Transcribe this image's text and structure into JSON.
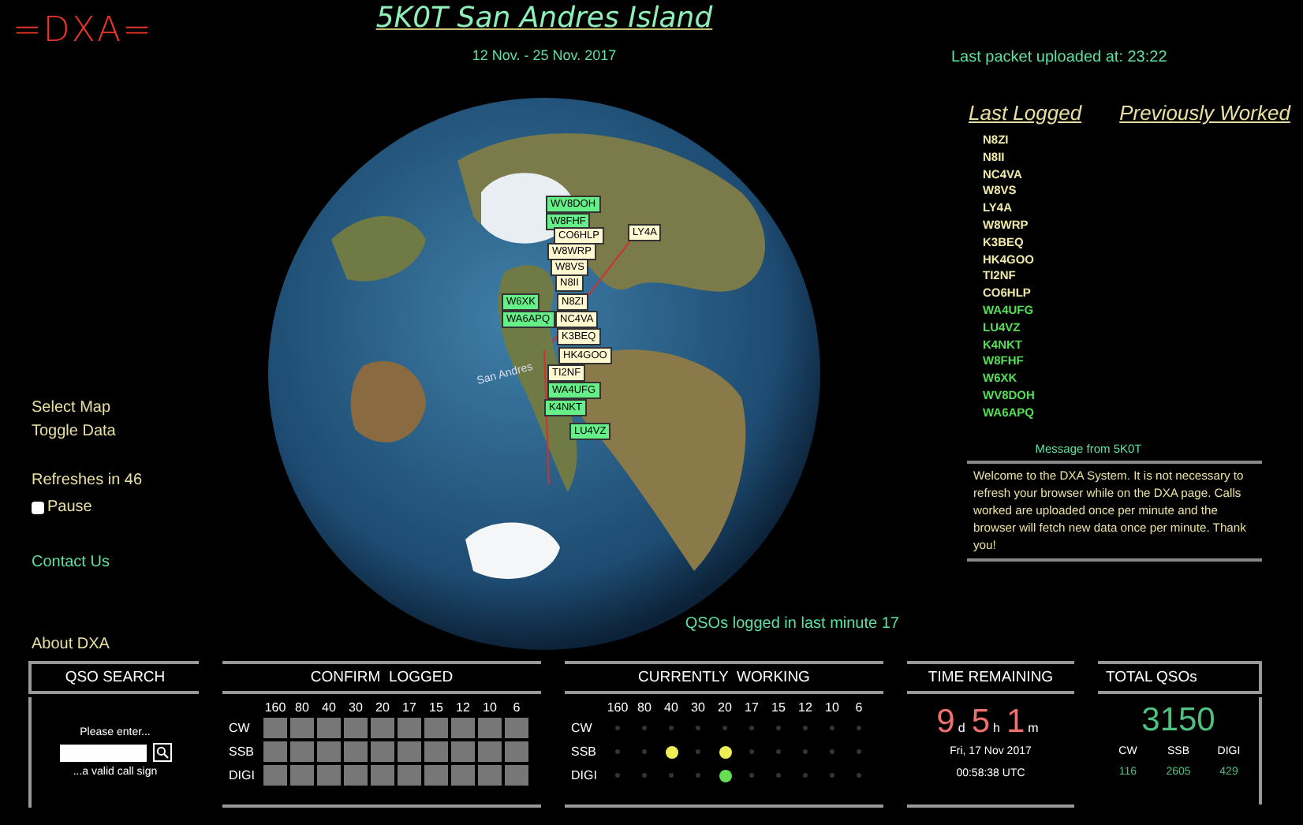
{
  "logo": "=DXA=",
  "title": "5K0T San Andres Island",
  "dates": "12 Nov. - 25 Nov. 2017",
  "last_packet": "Last packet uploaded at: 23:22",
  "nav": [
    {
      "label": "Select Map"
    },
    {
      "label": "Toggle Data"
    }
  ],
  "refresh": "Refreshes in 46",
  "pause": {
    "label": "Pause",
    "checked": false
  },
  "contact": "Contact Us",
  "about": "About DXA",
  "map": {
    "location_label": "San Andres",
    "markers": [
      {
        "call": "WV8DOH",
        "color": "#66ee88"
      },
      {
        "call": "W8FHF",
        "color": "#66ee88"
      },
      {
        "call": "CO6HLP",
        "color": "#fff8d0"
      },
      {
        "call": "LY4A",
        "color": "#fff8d0"
      },
      {
        "call": "W8WRP",
        "color": "#fff8d0"
      },
      {
        "call": "W8VS",
        "color": "#fff8d0"
      },
      {
        "call": "N8II",
        "color": "#fff8d0"
      },
      {
        "call": "W6XK",
        "color": "#66ee88"
      },
      {
        "call": "N8ZI",
        "color": "#fff8d0"
      },
      {
        "call": "WA6APQ",
        "color": "#66ee88"
      },
      {
        "call": "NC4VA",
        "color": "#fff8d0"
      },
      {
        "call": "K3BEQ",
        "color": "#fff8d0"
      },
      {
        "call": "HK4GOO",
        "color": "#fff8d0"
      },
      {
        "call": "TI2NF",
        "color": "#fff8d0"
      },
      {
        "call": "WA4UFG",
        "color": "#66ee88"
      },
      {
        "call": "K4NKT",
        "color": "#66ee88"
      },
      {
        "call": "LU4VZ",
        "color": "#66ee88"
      }
    ]
  },
  "qsos_last_minute": "QSOs logged in last minute 17",
  "list_headers": [
    {
      "label": "Last Logged"
    },
    {
      "label": "Previously Worked"
    }
  ],
  "last_logged": [
    {
      "call": "N8ZI",
      "color": "#f0e8a8"
    },
    {
      "call": "N8II",
      "color": "#f0e8a8"
    },
    {
      "call": "NC4VA",
      "color": "#f0e8a8"
    },
    {
      "call": "W8VS",
      "color": "#f0e8a8"
    },
    {
      "call": "LY4A",
      "color": "#f0e8a8"
    },
    {
      "call": "W8WRP",
      "color": "#f0e8a8"
    },
    {
      "call": "K3BEQ",
      "color": "#f0e8a8"
    },
    {
      "call": "HK4GOO",
      "color": "#f0e8a8"
    },
    {
      "call": "TI2NF",
      "color": "#f0e8a8"
    },
    {
      "call": "CO6HLP",
      "color": "#f0e8a8"
    },
    {
      "call": "WA4UFG",
      "color": "#55dd55"
    },
    {
      "call": "LU4VZ",
      "color": "#55dd55"
    },
    {
      "call": "K4NKT",
      "color": "#55dd55"
    },
    {
      "call": "W8FHF",
      "color": "#55dd55"
    },
    {
      "call": "W6XK",
      "color": "#55dd55"
    },
    {
      "call": "WV8DOH",
      "color": "#55dd55"
    },
    {
      "call": "WA6APQ",
      "color": "#55dd55"
    }
  ],
  "message": {
    "title": "Message from 5K0T",
    "text": "Welcome to the DXA System. It is not necessary to refresh your browser while on the DXA page. Calls worked are uploaded once per minute and the browser will fetch new data once per minute. Thank you!"
  },
  "qso_search": {
    "title": "QSO SEARCH",
    "hint_above": "Please enter...",
    "hint_below": "...a valid call sign"
  },
  "confirm_logged": {
    "title": "CONFIRM  LOGGED",
    "bands": [
      "160",
      "80",
      "40",
      "30",
      "20",
      "17",
      "15",
      "12",
      "10",
      "6"
    ],
    "rows": [
      {
        "mode": "CW",
        "confirmed": [
          false,
          false,
          false,
          false,
          false,
          false,
          false,
          false,
          false,
          false
        ]
      },
      {
        "mode": "SSB",
        "confirmed": [
          false,
          false,
          false,
          false,
          false,
          false,
          false,
          false,
          false,
          false
        ]
      },
      {
        "mode": "DIGI",
        "confirmed": [
          false,
          false,
          false,
          false,
          false,
          false,
          false,
          false,
          false,
          false
        ]
      }
    ]
  },
  "currently_working": {
    "title": "CURRENTLY  WORKING",
    "bands": [
      "160",
      "80",
      "40",
      "30",
      "20",
      "17",
      "15",
      "12",
      "10",
      "6"
    ],
    "rows": [
      {
        "mode": "CW",
        "active": [
          false,
          false,
          false,
          false,
          false,
          false,
          false,
          false,
          false,
          false
        ]
      },
      {
        "mode": "SSB",
        "color": "#eeee55",
        "active": [
          false,
          false,
          true,
          false,
          true,
          false,
          false,
          false,
          false,
          false
        ]
      },
      {
        "mode": "DIGI",
        "color": "#66dd55",
        "active": [
          false,
          false,
          false,
          false,
          true,
          false,
          false,
          false,
          false,
          false
        ]
      }
    ]
  },
  "time_remaining": {
    "title": "TIME REMAINING",
    "parts": [
      {
        "value": "9",
        "unit": "d"
      },
      {
        "value": "5",
        "unit": "h"
      },
      {
        "value": "1",
        "unit": "m"
      }
    ],
    "date": "Fri, 17 Nov 2017",
    "time": "00:58:38 UTC"
  },
  "total_qsos": {
    "title": "TOTAL QSOs",
    "total": "3150",
    "modes": [
      {
        "label": "CW",
        "count": "116"
      },
      {
        "label": "SSB",
        "count": "2605"
      },
      {
        "label": "DIGI",
        "count": "429"
      }
    ]
  }
}
